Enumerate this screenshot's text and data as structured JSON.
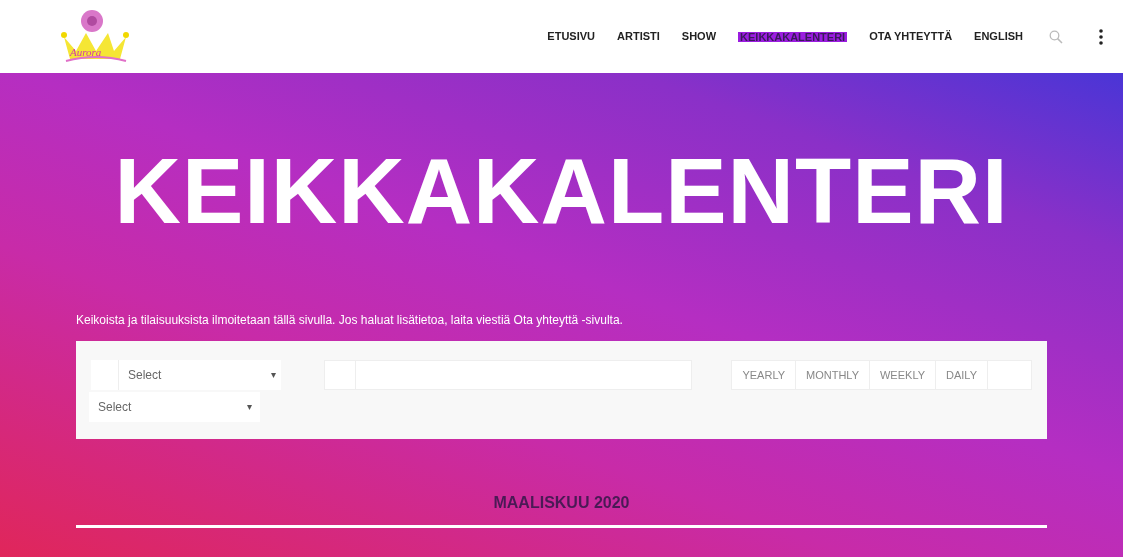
{
  "logo": {
    "text": "Aurora"
  },
  "nav": [
    {
      "label": "ETUSIVU",
      "selected": false
    },
    {
      "label": "ARTISTI",
      "selected": false
    },
    {
      "label": "SHOW",
      "selected": false
    },
    {
      "label": "KEIKKAKALENTERI",
      "selected": true
    },
    {
      "label": "OTA YHTEYTTÄ",
      "selected": false
    },
    {
      "label": "ENGLISH",
      "selected": false
    }
  ],
  "hero": {
    "title": "KEIKKAKALENTERI",
    "intro": "Keikoista ja tilaisuuksista ilmoitetaan tällä sivulla. Jos haluat lisätietoa, laita viestiä Ota yhteyttä -sivulta."
  },
  "filters": {
    "select_1": {
      "value": "Select",
      "arrow": "▾"
    },
    "select_2": {
      "value": "Select",
      "arrow": "▾"
    },
    "views": [
      {
        "label": "YEARLY",
        "selected": false
      },
      {
        "label": "MONTHLY",
        "selected": false
      },
      {
        "label": "WEEKLY",
        "selected": false
      },
      {
        "label": "DAILY",
        "selected": false
      }
    ]
  },
  "month_heading": "MAALISKUU 2020"
}
